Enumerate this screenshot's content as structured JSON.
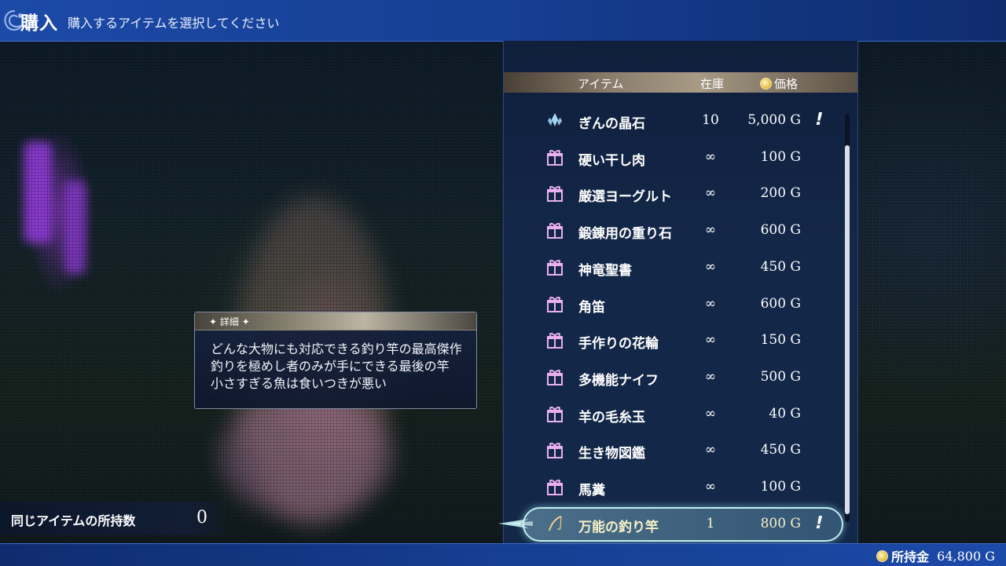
{
  "header": {
    "title": "購入",
    "subtitle": "購入するアイテムを選択してください"
  },
  "columns": {
    "item": "アイテム",
    "stock": "在庫",
    "price": "価格"
  },
  "items": [
    {
      "icon": "crystal-icon",
      "name": "ぎんの晶石",
      "stock": "10",
      "price": "5,000 G",
      "flag": "!"
    },
    {
      "icon": "gift-icon",
      "name": "硬い干し肉",
      "stock": "∞",
      "price": "100 G",
      "flag": ""
    },
    {
      "icon": "gift-icon",
      "name": "厳選ヨーグルト",
      "stock": "∞",
      "price": "200 G",
      "flag": ""
    },
    {
      "icon": "gift-icon",
      "name": "鍛錬用の重り石",
      "stock": "∞",
      "price": "600 G",
      "flag": ""
    },
    {
      "icon": "gift-icon",
      "name": "神竜聖書",
      "stock": "∞",
      "price": "450 G",
      "flag": ""
    },
    {
      "icon": "gift-icon",
      "name": "角笛",
      "stock": "∞",
      "price": "600 G",
      "flag": ""
    },
    {
      "icon": "gift-icon",
      "name": "手作りの花輪",
      "stock": "∞",
      "price": "150 G",
      "flag": ""
    },
    {
      "icon": "gift-icon",
      "name": "多機能ナイフ",
      "stock": "∞",
      "price": "500 G",
      "flag": ""
    },
    {
      "icon": "gift-icon",
      "name": "羊の毛糸玉",
      "stock": "∞",
      "price": "40 G",
      "flag": ""
    },
    {
      "icon": "gift-icon",
      "name": "生き物図鑑",
      "stock": "∞",
      "price": "450 G",
      "flag": ""
    },
    {
      "icon": "gift-icon",
      "name": "馬糞",
      "stock": "∞",
      "price": "100 G",
      "flag": ""
    },
    {
      "icon": "fishing-rod-icon",
      "name": "万能の釣り竿",
      "stock": "1",
      "price": "800 G",
      "flag": "!"
    }
  ],
  "selected_index": 11,
  "detail": {
    "title": "詳細",
    "lines": [
      "どんな大物にも対応できる釣り竿の最高傑作",
      "釣りを極めし者のみが手にできる最後の竿",
      "小さすぎる魚は食いつきが悪い"
    ]
  },
  "owned": {
    "label": "同じアイテムの所持数",
    "value": "0"
  },
  "money": {
    "label": "所持金",
    "value": "64,800 G"
  },
  "colors": {
    "gift": "#e8b0f0",
    "crystal": "#a9d6f2",
    "selection": "#bfeef0",
    "header": "#1c4aa8"
  }
}
